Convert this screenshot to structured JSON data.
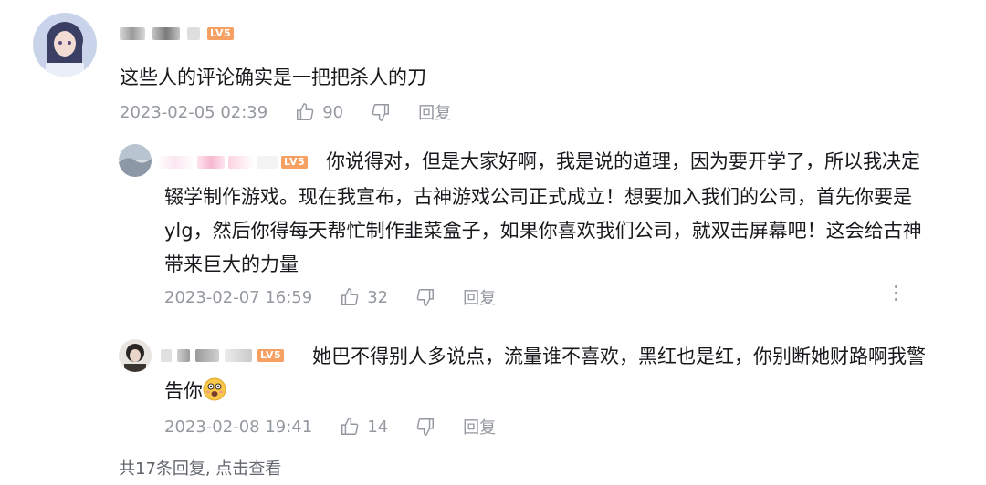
{
  "main_comment": {
    "level_badge": "LV5",
    "text": "这些人的评论确实是一把把杀人的刀",
    "time": "2023-02-05 02:39",
    "likes": "90",
    "reply_label": "回复"
  },
  "replies": [
    {
      "level_badge": "LV5",
      "line1": "你说得对，但是大家好啊，我是说的道理，因为要开学了，所以我决定",
      "line2": "辍学制作游戏。现在我宣布，古神游戏公司正式成立！想要加入我们的公司，首先你要是",
      "line3": "ylg，然后你得每天帮忙制作韭菜盒子，如果你喜欢我们公司，就双击屏幕吧！这会给古神",
      "line4": "带来巨大的力量",
      "time": "2023-02-07 16:59",
      "likes": "32",
      "reply_label": "回复"
    },
    {
      "level_badge": "LV5",
      "line1": "她巴不得别人多说点，流量谁不喜欢，黑红也是红，你别断她财路啊我警",
      "line2": "告你",
      "time": "2023-02-08 19:41",
      "likes": "14",
      "reply_label": "回复"
    }
  ],
  "footer": {
    "reply_summary": "共17条回复, 点击查看"
  },
  "colors": {
    "text": "#18191c",
    "meta": "#9499a0",
    "badge": "#f6a163"
  }
}
